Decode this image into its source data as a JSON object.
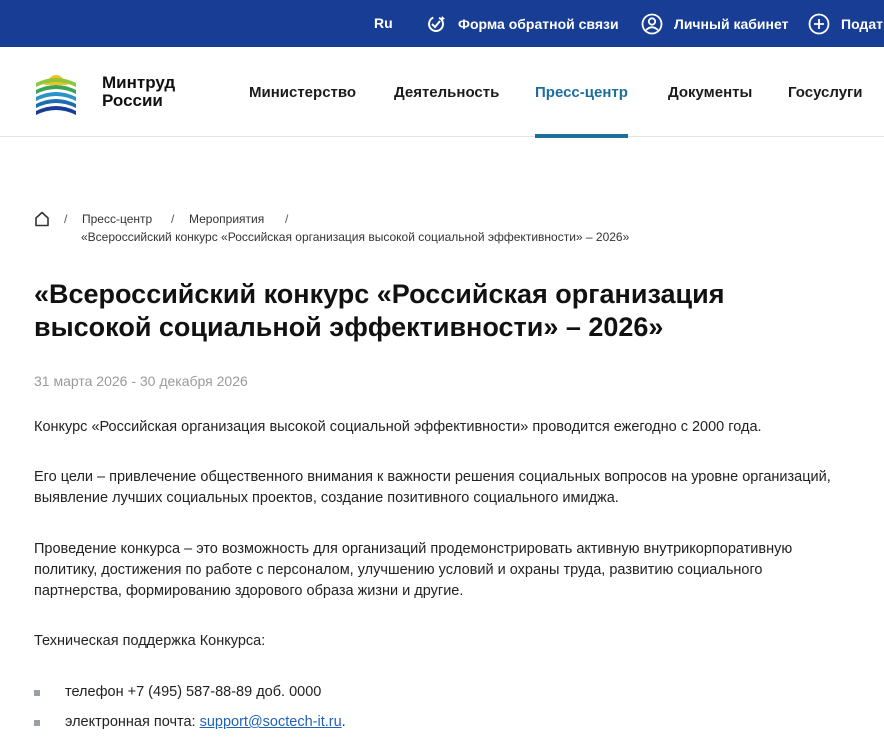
{
  "topbar": {
    "lang": "Ru",
    "feedback_label": "Форма обратной связи",
    "cabinet_label": "Личный кабинет",
    "submit_label": "Подать",
    "bg_color": "#173d95"
  },
  "header": {
    "logo_line1": "Минтруд",
    "logo_line2": "России",
    "nav": [
      {
        "label": "Министерство"
      },
      {
        "label": "Деятельность"
      },
      {
        "label": "Пресс-центр"
      },
      {
        "label": "Документы"
      },
      {
        "label": "Госуслуги"
      }
    ],
    "active_nav": "Пресс-центр",
    "accent_color": "#1c6f9a"
  },
  "breadcrumb": {
    "items": [
      "Пресс-центр",
      "Мероприятия"
    ],
    "separator": "/",
    "current": "«Всероссийский конкурс «Российская организация высокой социальной эффективности» – 2026»"
  },
  "article": {
    "title": "«Всероссийский конкурс «Российская организация высокой социальной эффективности» – 2026»",
    "date": "31 марта 2026 - 30 декабря 2026",
    "paragraphs": [
      "Конкурс «Российская организация высокой социальной эффективности» проводится ежегодно с 2000 года.",
      "Его цели – привлечение общественного внимания к важности решения социальных вопросов на уровне организаций, выявление лучших социальных проектов, создание позитивного социального имиджа.",
      "Проведение конкурса – это возможность для организаций продемонстрировать активную внутрикорпоративную политику, достижения по работе с персоналом, улучшению условий и охраны труда, развитию социального партнерства, формированию здорового образа жизни и другие.",
      "Техническая поддержка Конкурса:"
    ],
    "contacts": {
      "phone": "телефон +7 (495) 587-88-89 доб. 0000",
      "email_prefix": "электронная почта: ",
      "email": "support@soctech-it.ru",
      "email_suffix": "."
    }
  }
}
